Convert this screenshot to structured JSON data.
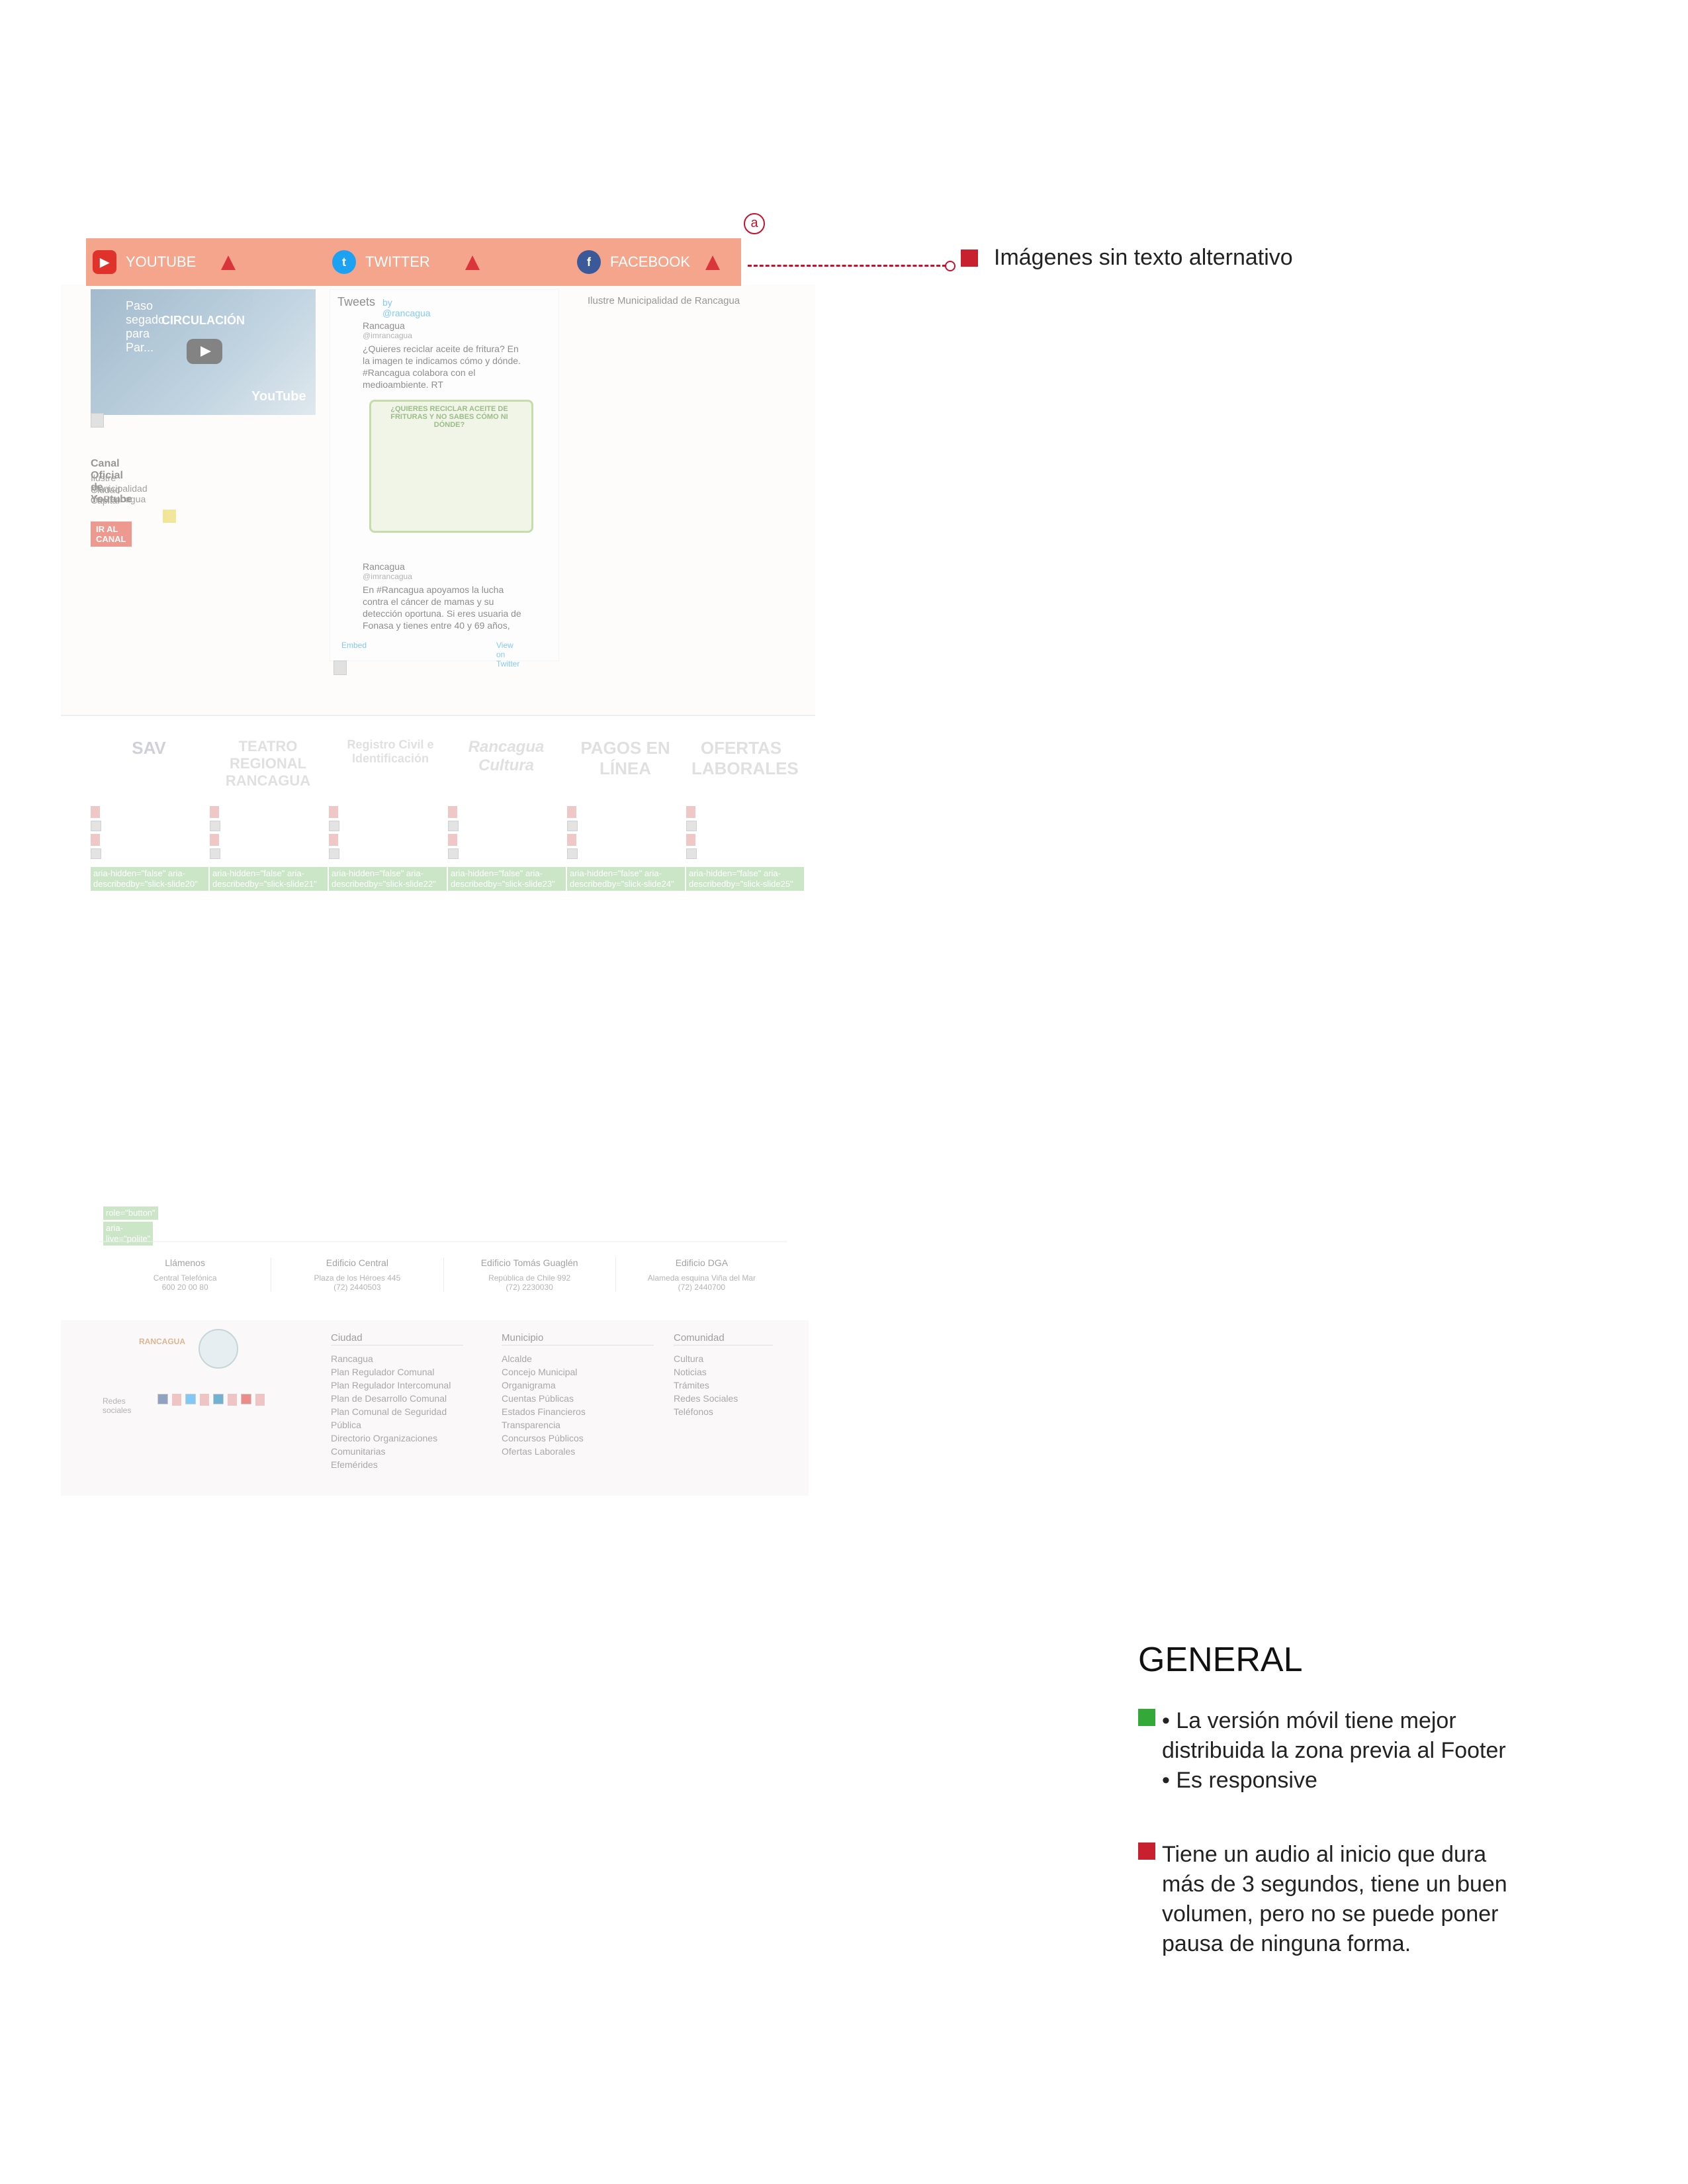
{
  "social": {
    "youtube": "YOUTUBE",
    "twitter": "TWITTER",
    "facebook": "FACEBOOK",
    "marker": "a"
  },
  "annotation": {
    "label": "Imágenes sin texto alternativo"
  },
  "youtube_widget": {
    "video_title": "Paso segado para Par...",
    "video_subtitle": "CIRCULACIÓN",
    "brand": "YouTube",
    "channel_title": "Canal Oficial de Youtube",
    "channel_org": "Ilustre Municipalidad de Rancagua",
    "channel_city": "Ciudad Capital",
    "button": "IR AL CANAL"
  },
  "twitter_widget": {
    "header": "Tweets",
    "handle": "by @rancagua",
    "tweet1_user": "Rancagua",
    "tweet1_handle": "@imrancagua",
    "tweet1_text": "¿Quieres reciclar aceite de fritura? En la imagen te indicamos cómo y dónde. #Rancagua colabora con el medioambiente. RT",
    "infographic_title": "¿QUIERES RECICLAR ACEITE DE FRITURAS Y NO SABES CÓMO NI DÓNDE?",
    "tweet2_user": "Rancagua",
    "tweet2_handle": "@imrancagua",
    "tweet2_text": "En #Rancagua apoyamos la lucha contra el cáncer de mamas y su detección oportuna. Si eres usuaria de Fonasa y tienes entre 40 y 69 años,",
    "embed": "Embed",
    "view_on": "View on Twitter"
  },
  "facebook_widget": {
    "page_name": "Ilustre Municipalidad de Rancagua"
  },
  "logos": [
    "SAV",
    "TEATRO REGIONAL RANCAGUA",
    "Registro Civil e Identificación",
    "Rancagua Cultura",
    "PAGOS EN LÍNEA",
    "OFERTAS LABORALES"
  ],
  "slide_chips": [
    "aria-hidden=\"false\" aria-describedby=\"slick-slide20\"",
    "aria-hidden=\"false\" aria-describedby=\"slick-slide21\"",
    "aria-hidden=\"false\" aria-describedby=\"slick-slide22\"",
    "aria-hidden=\"false\" aria-describedby=\"slick-slide23\"",
    "aria-hidden=\"false\" aria-describedby=\"slick-slide24\"",
    "aria-hidden=\"false\" aria-describedby=\"slick-slide25\""
  ],
  "role_chips": [
    "role=\"button\"",
    "aria-live=\"polite\""
  ],
  "contacts": [
    {
      "title": "Llámenos",
      "line1": "Central Telefónica",
      "line2": "600 20 00 80"
    },
    {
      "title": "Edificio Central",
      "line1": "Plaza de los Héroes 445",
      "line2": "(72) 2440503"
    },
    {
      "title": "Edificio Tomás Guaglén",
      "line1": "República de Chile 992",
      "line2": "(72) 2230030"
    },
    {
      "title": "Edificio DGA",
      "line1": "Alameda esquina Viña del Mar",
      "line2": "(72) 2440700"
    }
  ],
  "footer": {
    "brand": "RANCAGUA",
    "social_label": "Redes sociales",
    "cols": [
      {
        "title": "Ciudad",
        "items": [
          "Rancagua",
          "Plan Regulador Comunal",
          "Plan Regulador Intercomunal",
          "Plan de Desarrollo Comunal",
          "Plan Comunal de Seguridad Pública",
          "Directorio Organizaciones Comunitarias",
          "Efemérides"
        ]
      },
      {
        "title": "Municipio",
        "items": [
          "Alcalde",
          "Concejo Municipal",
          "Organigrama",
          "Cuentas Públicas",
          "Estados Financieros",
          "Transparencia",
          "Concursos Públicos",
          "Ofertas Laborales"
        ]
      },
      {
        "title": "Comunidad",
        "items": [
          "Cultura",
          "Noticias",
          "Trámites",
          "Redes Sociales",
          "Teléfonos"
        ]
      }
    ]
  },
  "general": {
    "title": "GENERAL",
    "green_line1": "• La versión móvil tiene mejor",
    "green_line2": "distribuida la zona previa al Footer",
    "green_line3": "• Es responsive",
    "red_line1": "Tiene un audio al inicio que dura",
    "red_line2": "más de 3 segundos, tiene un buen",
    "red_line3": "volumen, pero no se puede poner",
    "red_line4": "pausa de ninguna forma."
  },
  "colors": {
    "accent_red": "#c8202f",
    "accent_green": "#35a83a",
    "highlight_bar": "#f4a58c"
  }
}
